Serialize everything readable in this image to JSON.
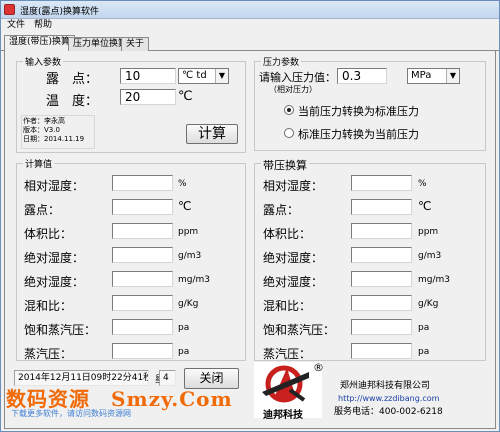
{
  "window": {
    "title": "湿度(露点)换算软件"
  },
  "menu": {
    "file": "文件",
    "help": "帮助"
  },
  "tabs": [
    {
      "label": "湿度(带压)换算"
    },
    {
      "label": "压力单位换算"
    },
    {
      "label": "关于"
    }
  ],
  "input_params": {
    "title": "输入参数",
    "dew_point_label": "露　点：",
    "dew_point_value": "10",
    "dew_unit_selected": "℃ td",
    "temperature_label": "温　度：",
    "temperature_value": "20",
    "temperature_unit": "℃",
    "author": "作者：李永高",
    "version": "版本：V3.0",
    "date": "日期：2014.11.19",
    "calc_button": "计算"
  },
  "pressure_params": {
    "title": "压力参数",
    "input_label": "请输入压力值：",
    "input_note": "（相对压力）",
    "pressure_value": "0.3",
    "unit_selected": "MPa",
    "radio1_label": "当前压力转换为标准压力",
    "radio1_checked": true,
    "radio2_label": "标准压力转换为当前压力",
    "radio2_checked": false
  },
  "results": {
    "title": "计算值",
    "rows": [
      {
        "label": "相对湿度：",
        "unit": "%"
      },
      {
        "label": "露点：",
        "unit": "℃"
      },
      {
        "label": "体积比：",
        "unit": "ppm"
      },
      {
        "label": "绝对湿度：",
        "unit": "g/m3"
      },
      {
        "label": "绝对湿度：",
        "unit": "mg/m3"
      },
      {
        "label": "混和比：",
        "unit": "g/Kg"
      },
      {
        "label": "饱和蒸汽压：",
        "unit": "pa"
      },
      {
        "label": "蒸汽压：",
        "unit": "pa"
      }
    ]
  },
  "pressure_results": {
    "title": "带压换算",
    "rows": [
      {
        "label": "相对湿度：",
        "unit": "%"
      },
      {
        "label": "露点：",
        "unit": "℃"
      },
      {
        "label": "体积比：",
        "unit": "ppm"
      },
      {
        "label": "绝对湿度：",
        "unit": "g/m3"
      },
      {
        "label": "绝对湿度：",
        "unit": "mg/m3"
      },
      {
        "label": "混和比：",
        "unit": "g/Kg"
      },
      {
        "label": "饱和蒸汽压：",
        "unit": "pa"
      },
      {
        "label": "蒸汽压：",
        "unit": "pa"
      }
    ]
  },
  "status": {
    "datetime": "2014年12月11日09时22分41秒",
    "weekday_label": "星期",
    "weekday_value": "4",
    "close_button": "关闭"
  },
  "company": {
    "logo_name": "迪邦科技",
    "registered_mark": "®",
    "name": "郑州迪邦科技有限公司",
    "website": "http://www.zzdibang.com",
    "hotline": "服务电话：400-002-6218"
  },
  "watermark": {
    "main": "数码资源　Smzy.Com",
    "sub": "下载更多软件，请访问数码资源网"
  },
  "colors": {
    "logo_red": "#c81f1f",
    "watermark_orange": "#f06a08"
  }
}
